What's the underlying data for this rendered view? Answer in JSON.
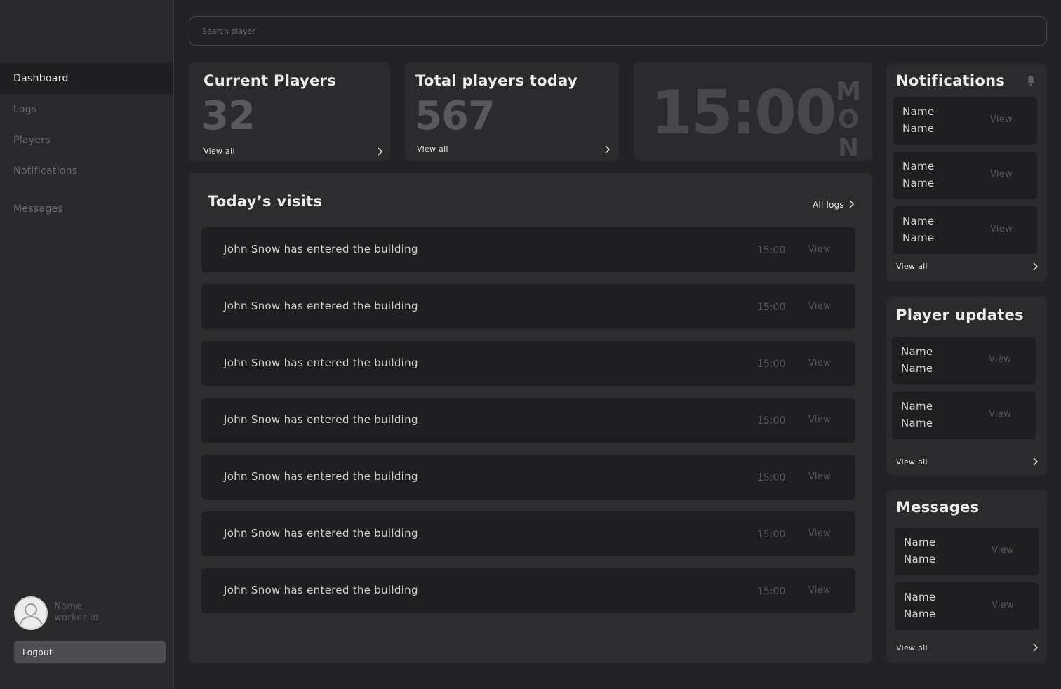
{
  "sidebar": {
    "nav": [
      {
        "label": "Dashboard",
        "active": true
      },
      {
        "label": "Logs",
        "active": false
      },
      {
        "label": "Players",
        "active": false
      },
      {
        "label": "Notifications",
        "active": false
      },
      {
        "label": "Messages",
        "active": false
      }
    ],
    "user": {
      "name": "Name",
      "worker_id": "worker id"
    },
    "logout_label": "Logout"
  },
  "search": {
    "placeholder": "Search player"
  },
  "current_players": {
    "title": "Current Players",
    "value": "32",
    "link": "View all"
  },
  "total_players": {
    "title": "Total players today",
    "value": "567",
    "link": "View all"
  },
  "clock": {
    "time": "15:00",
    "day_letters": [
      "M",
      "O",
      "N"
    ]
  },
  "visits": {
    "title": "Today’s visits",
    "all_logs_label": "All logs",
    "rows": [
      {
        "text": "John Snow has entered the building",
        "time": "15:00",
        "action": "View"
      },
      {
        "text": "John Snow has entered the building",
        "time": "15:00",
        "action": "View"
      },
      {
        "text": "John Snow has entered the building",
        "time": "15:00",
        "action": "View"
      },
      {
        "text": "John Snow has entered the building",
        "time": "15:00",
        "action": "View"
      },
      {
        "text": "John Snow has entered the building",
        "time": "15:00",
        "action": "View"
      },
      {
        "text": "John Snow has entered the building",
        "time": "15:00",
        "action": "View"
      },
      {
        "text": "John Snow has entered the building",
        "time": "15:00",
        "action": "View"
      }
    ]
  },
  "notifications": {
    "title": "Notifications",
    "icon": "bell-icon",
    "items": [
      {
        "first": "Name",
        "last": "Name",
        "action": "View"
      },
      {
        "first": "Name",
        "last": "Name",
        "action": "View"
      },
      {
        "first": "Name",
        "last": "Name",
        "action": "View"
      }
    ],
    "link": "View all"
  },
  "player_updates": {
    "title": "Player updates",
    "items": [
      {
        "first": "Name",
        "last": "Name",
        "action": "View"
      },
      {
        "first": "Name",
        "last": "Name",
        "action": "View"
      }
    ],
    "link": "View all"
  },
  "messages": {
    "title": "Messages",
    "items": [
      {
        "first": "Name",
        "last": "Name",
        "action": "View"
      },
      {
        "first": "Name",
        "last": "Name",
        "action": "View"
      }
    ],
    "link": "View all"
  }
}
